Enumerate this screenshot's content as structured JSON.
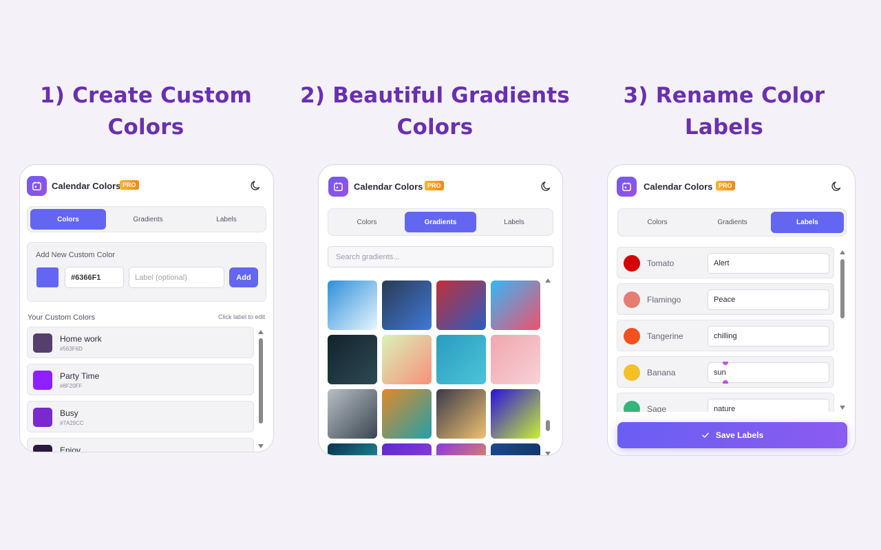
{
  "headings": [
    {
      "line1": "1) Create Custom",
      "line2": "Colors"
    },
    {
      "line1": "2) Beautiful Gradients",
      "line2": "Colors"
    },
    {
      "line1": "3) Rename Color",
      "line2": "Labels"
    }
  ],
  "app": {
    "title": "Calendar Colors",
    "badge": "PRO"
  },
  "tabs": [
    "Colors",
    "Gradients",
    "Labels"
  ],
  "panel1": {
    "add_title": "Add New Custom Color",
    "swatch_color": "#6366F1",
    "hex_value": "#6366F1",
    "label_placeholder": "Label (optional)",
    "add_button": "Add",
    "section_title": "Your Custom Colors",
    "section_hint": "Click label to edit",
    "items": [
      {
        "name": "Home work",
        "hex": "#563F6D",
        "color": "#563F6D"
      },
      {
        "name": "Party Time",
        "hex": "#8F20FF",
        "color": "#8F20FF"
      },
      {
        "name": "Busy",
        "hex": "#7A29CC",
        "color": "#7A29CC"
      },
      {
        "name": "Enjoy",
        "hex": "",
        "color": "#2a1a40"
      }
    ]
  },
  "panel2": {
    "search_placeholder": "Search gradients...",
    "gradients": [
      {
        "from": "#2f8fd8",
        "to": "#e6f6ff"
      },
      {
        "from": "#2b3a55",
        "to": "#3f7ad8"
      },
      {
        "from": "#c0303a",
        "to": "#2a5cbf"
      },
      {
        "from": "#35b8f5",
        "to": "#f0506e"
      },
      {
        "from": "#12232b",
        "to": "#2e4a55"
      },
      {
        "from": "#d8f2b8",
        "to": "#f7907a"
      },
      {
        "from": "#2a9cc0",
        "to": "#4cc4d8"
      },
      {
        "from": "#f0a6ae",
        "to": "#f7d2d6"
      },
      {
        "from": "#b7bec6",
        "to": "#3a4650"
      },
      {
        "from": "#e08a2a",
        "to": "#22a0a8"
      },
      {
        "from": "#3a3a4a",
        "to": "#f0c070"
      },
      {
        "from": "#2a10e0",
        "to": "#c8f030"
      },
      {
        "from": "#0e3050",
        "to": "#20b0b0"
      },
      {
        "from": "#5a2ad0",
        "to": "#a040e0"
      },
      {
        "from": "#8a3ae0",
        "to": "#ffa030"
      },
      {
        "from": "#1a4a90",
        "to": "#0e2a50"
      }
    ]
  },
  "panel3": {
    "rows": [
      {
        "name": "Tomato",
        "value": "Alert",
        "color": "#D50000"
      },
      {
        "name": "Flamingo",
        "value": "Peace",
        "color": "#E67C73"
      },
      {
        "name": "Tangerine",
        "value": "chilling",
        "color": "#F4511E"
      },
      {
        "name": "Banana",
        "value": "sun",
        "color": "#F6BF26"
      },
      {
        "name": "Sage",
        "value": "nature",
        "color": "#33B679"
      }
    ],
    "save_button": "Save Labels"
  }
}
